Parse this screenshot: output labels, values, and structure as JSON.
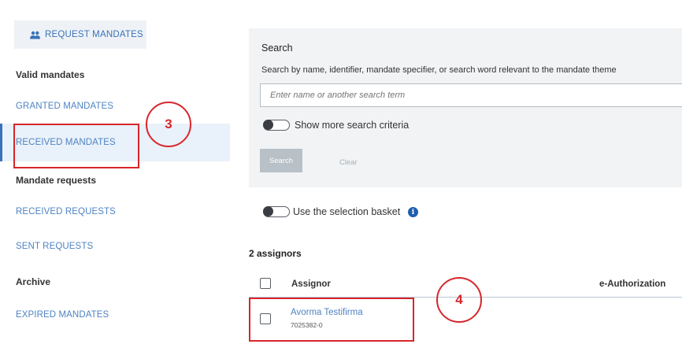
{
  "sidebar": {
    "request_button_label": "REQUEST MANDATES",
    "valid_heading": "Valid mandates",
    "granted_link": "GRANTED MANDATES",
    "received_link": "RECEIVED MANDATES",
    "requests_heading": "Mandate requests",
    "received_requests_link": "RECEIVED REQUESTS",
    "sent_requests_link": "SENT REQUESTS",
    "archive_heading": "Archive",
    "expired_link": "EXPIRED MANDATES"
  },
  "annotations": {
    "step_3": "3",
    "step_4": "4",
    "color": "#d7262c"
  },
  "search": {
    "title": "Search",
    "description": "Search by name, identifier, mandate specifier, or search word relevant to the mandate theme",
    "placeholder": "Enter name or another search term",
    "more_criteria_label": "Show more search criteria",
    "search_button": "Search",
    "clear_button": "Clear"
  },
  "basket": {
    "label": "Use the selection basket",
    "info_icon_glyph": "i"
  },
  "results": {
    "count_label": "2 assignors",
    "columns": {
      "assignor": "Assignor",
      "e_authorization": "e-Authorization"
    },
    "rows": [
      {
        "name": "Avorma Testifirma",
        "id": "7025382-0"
      }
    ]
  },
  "colors": {
    "link_blue": "#4f83c2",
    "accent_blue": "#3a73b8",
    "active_bg": "#e9f1fa",
    "panel_bg": "#f1f3f5"
  }
}
